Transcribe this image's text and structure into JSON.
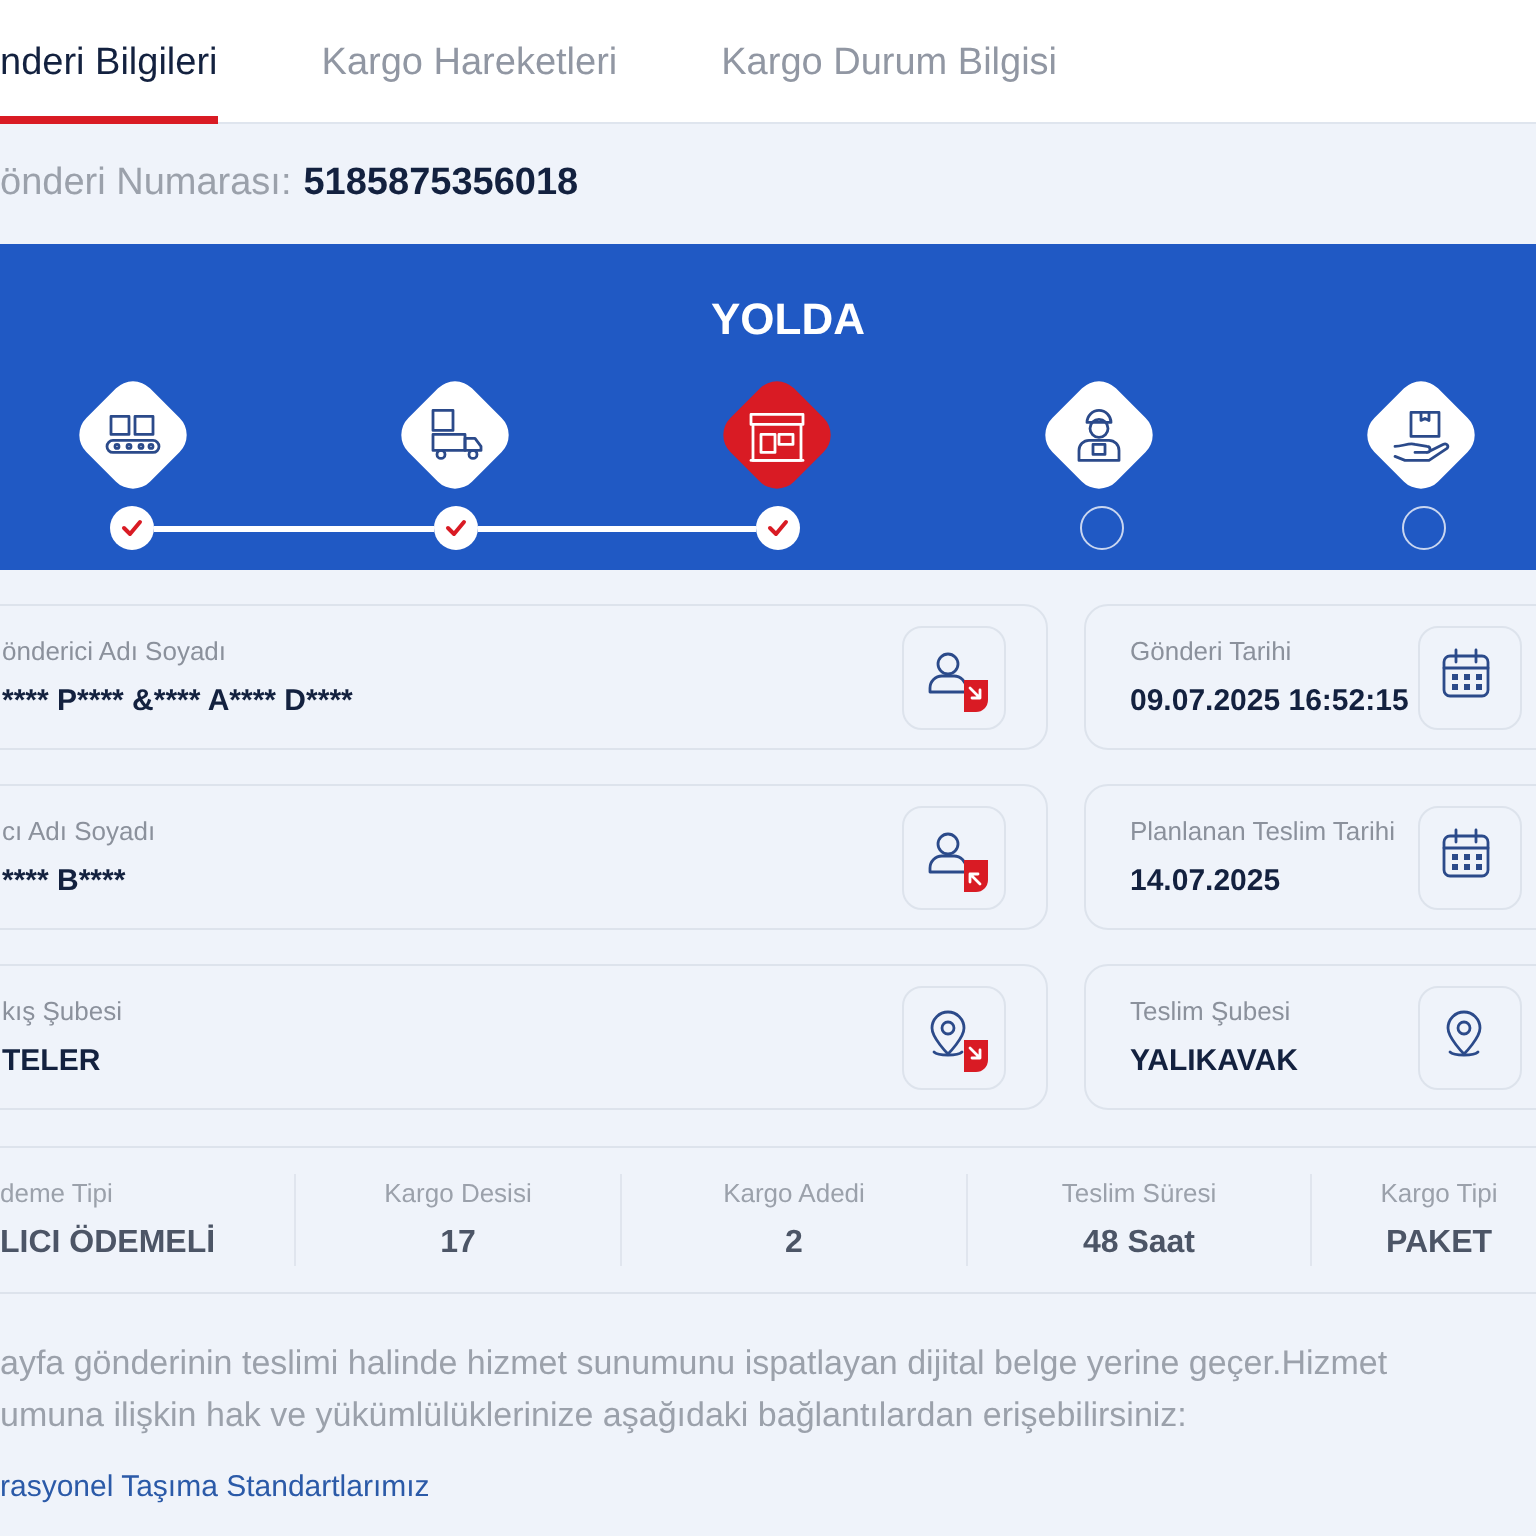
{
  "tabs": [
    {
      "label": "nderi Bilgileri",
      "selected": true
    },
    {
      "label": "Kargo Hareketleri",
      "selected": false
    },
    {
      "label": "Kargo Durum Bilgisi",
      "selected": false
    }
  ],
  "shipment_number": {
    "label": "önderi Numarası:",
    "value": "5185875356018"
  },
  "status": {
    "title": "YOLDA",
    "steps": [
      {
        "kind": "sorting",
        "done": true,
        "current": false
      },
      {
        "kind": "truck",
        "done": true,
        "current": false
      },
      {
        "kind": "branch",
        "done": true,
        "current": true
      },
      {
        "kind": "courier",
        "done": false,
        "current": false
      },
      {
        "kind": "delivered",
        "done": false,
        "current": false
      }
    ]
  },
  "details": [
    {
      "left": {
        "label": "önderici Adı Soyadı",
        "value": "**** P**** &**** A**** D****",
        "kind": "sender"
      },
      "right": {
        "label": "Gönderi Tarihi",
        "value": "09.07.2025 16:52:15",
        "kind": "calendar"
      }
    },
    {
      "left": {
        "label": "cı Adı Soyadı",
        "value": "**** B****",
        "kind": "receiver"
      },
      "right": {
        "label": "Planlanan Teslim Tarihi",
        "value": "14.07.2025",
        "kind": "calendar"
      }
    },
    {
      "left": {
        "label": "kış Şubesi",
        "value": "TELER",
        "kind": "origin"
      },
      "right": {
        "label": "Teslim Şubesi",
        "value": "YALIKAVAK",
        "kind": "pin"
      }
    }
  ],
  "summary": [
    {
      "label": "deme Tipi",
      "value": "LICI ÖDEMELİ"
    },
    {
      "label": "Kargo Desisi",
      "value": "17"
    },
    {
      "label": "Kargo Adedi",
      "value": "2"
    },
    {
      "label": "Teslim Süresi",
      "value": "48 Saat"
    },
    {
      "label": "Kargo Tipi",
      "value": "PAKET"
    }
  ],
  "notice": "ayfa gönderinin teslimi halinde hizmet sunumunu ispatlayan dijital belge yerine geçer.Hizmet umuna ilişkin hak ve yükümlülüklerinize aşağıdaki bağlantılardan erişebilirsiniz:",
  "link": "rasyonel Taşıma Standartlarımız"
}
